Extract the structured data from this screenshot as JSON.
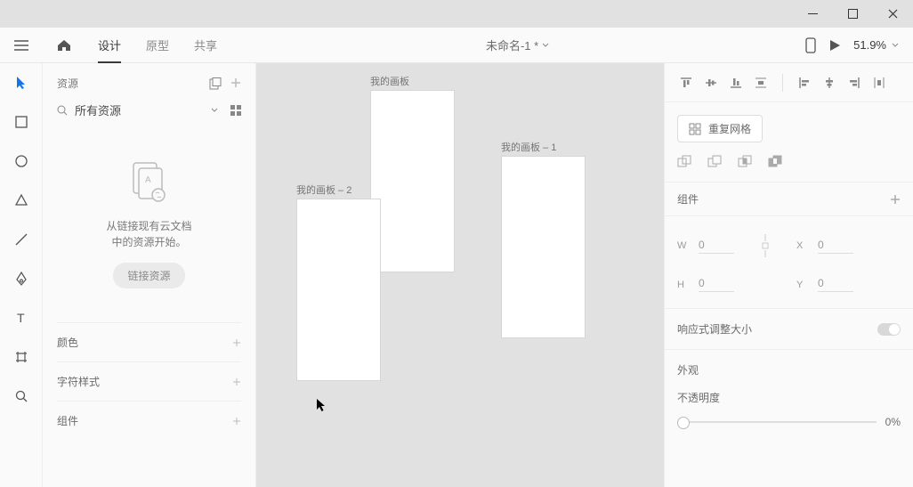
{
  "titlebar": {
    "minimize": "—",
    "maximize": "▢",
    "close": "✕"
  },
  "topbar": {
    "tabs": {
      "design": "设计",
      "prototype": "原型",
      "share": "共享"
    },
    "doc_title": "未命名-1 *",
    "zoom": "51.9%"
  },
  "left_panel": {
    "header": "资源",
    "search_label": "所有资源",
    "empty_msg1": "从链接现有云文档",
    "empty_msg2": "中的资源开始。",
    "link_btn": "链接资源",
    "sections": {
      "colors": "颜色",
      "charstyles": "字符样式",
      "components": "组件"
    }
  },
  "canvas": {
    "artboard1_label": "我的画板",
    "artboard2_label": "我的画板 – 1",
    "artboard3_label": "我的画板 – 2"
  },
  "right_panel": {
    "repeat_grid": "重复网格",
    "components_label": "组件",
    "transform": {
      "w": "0",
      "x": "0",
      "h": "0",
      "y": "0",
      "w_lab": "W",
      "x_lab": "X",
      "h_lab": "H",
      "y_lab": "Y"
    },
    "responsive": "响应式调整大小",
    "appearance": "外观",
    "opacity_label": "不透明度",
    "opacity_value": "0%"
  }
}
